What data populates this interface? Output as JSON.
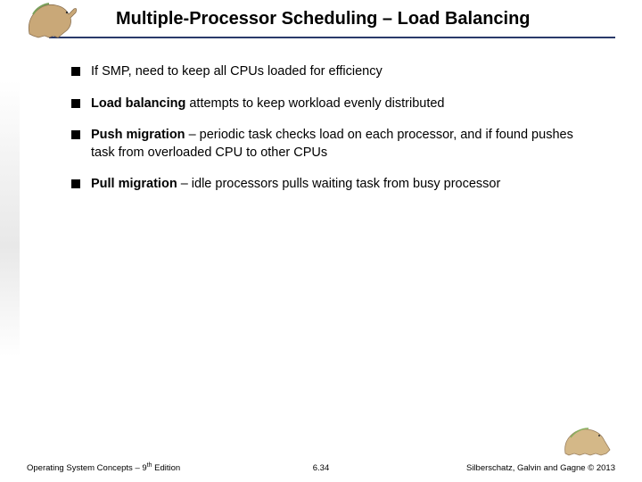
{
  "header": {
    "title": "Multiple-Processor Scheduling – Load Balancing"
  },
  "bullets": {
    "b0": {
      "plain": "If SMP, need to keep all CPUs loaded for efficiency"
    },
    "b1": {
      "bold": "Load balancing",
      "rest": " attempts to keep workload evenly distributed"
    },
    "b2": {
      "bold": "Push migration",
      "rest": " – periodic task checks load on each processor, and if found pushes task from overloaded CPU to other CPUs"
    },
    "b3": {
      "bold": "Pull migration",
      "rest": " – idle processors pulls waiting task from busy processor"
    }
  },
  "footer": {
    "left_prefix": "Operating System Concepts – 9",
    "left_sup": "th",
    "left_suffix": " Edition",
    "center": "6.34",
    "right": "Silberschatz, Galvin and Gagne © 2013"
  },
  "icons": {
    "dino_top": "dinosaur-icon",
    "dino_bottom": "dinosaur-icon"
  }
}
